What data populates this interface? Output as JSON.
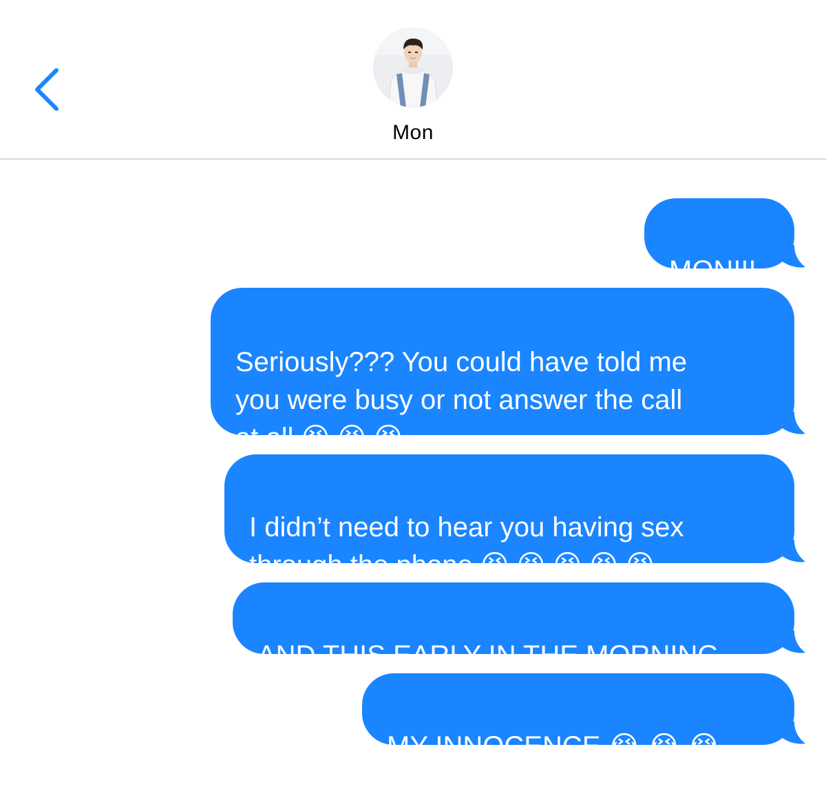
{
  "header": {
    "contact_name": "Mon",
    "back_icon": "chevron-left-icon",
    "accent_color": "#1a85ff"
  },
  "messages": [
    {
      "direction": "outgoing",
      "text": "MON!!!"
    },
    {
      "direction": "outgoing",
      "text": "Seriously??? You could have told me\nyou were busy or not answer the call\nat all 😫 😫 😫"
    },
    {
      "direction": "outgoing",
      "text": "I didn’t need to hear you having sex\nthrough the phone 😫 😫 😫 😫 😫"
    },
    {
      "direction": "outgoing",
      "text": "AND THIS EARLY IN THE MORNING"
    },
    {
      "direction": "outgoing",
      "text": "MY INNOCENCE 😭 😭 😭"
    }
  ]
}
